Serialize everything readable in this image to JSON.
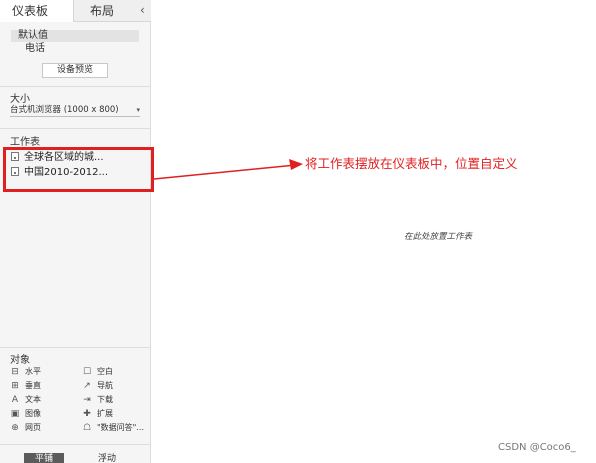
{
  "tabs": {
    "dashboard": "仪表板",
    "layout": "布局",
    "collapse_glyph": "‹"
  },
  "device": {
    "default": "默认值",
    "phone": "电话",
    "preview_button": "设备预览"
  },
  "size": {
    "title": "大小",
    "value": "台式机浏览器 (1000 x 800)",
    "caret": "▾"
  },
  "sheets": {
    "title": "工作表",
    "items": [
      "全球各区域的城...",
      "中国2010-2012..."
    ]
  },
  "annotation": {
    "text": "将工作表摆放在仪表板中，位置自定义",
    "color": "#e02020"
  },
  "canvas": {
    "placeholder": "在此处放置工作表"
  },
  "objects": {
    "title": "对象",
    "items": [
      {
        "label": "水平",
        "icon": "horizontal-icon",
        "glyph": "⊟"
      },
      {
        "label": "空白",
        "icon": "blank-icon",
        "glyph": "☐"
      },
      {
        "label": "垂直",
        "icon": "vertical-icon",
        "glyph": "⊞"
      },
      {
        "label": "导航",
        "icon": "navigation-icon",
        "glyph": "↗"
      },
      {
        "label": "文本",
        "icon": "text-icon",
        "glyph": "A"
      },
      {
        "label": "下载",
        "icon": "download-icon",
        "glyph": "⇥"
      },
      {
        "label": "图像",
        "icon": "image-icon",
        "glyph": "▣"
      },
      {
        "label": "扩展",
        "icon": "extension-icon",
        "glyph": "✚"
      },
      {
        "label": "网页",
        "icon": "webpage-icon",
        "glyph": "⊕"
      },
      {
        "label": "\"数据问答\"...",
        "icon": "ask-data-icon",
        "glyph": "☖"
      }
    ]
  },
  "layout_mode": {
    "tiled": "平铺",
    "floating": "浮动"
  },
  "watermark": "CSDN @Coco6_"
}
